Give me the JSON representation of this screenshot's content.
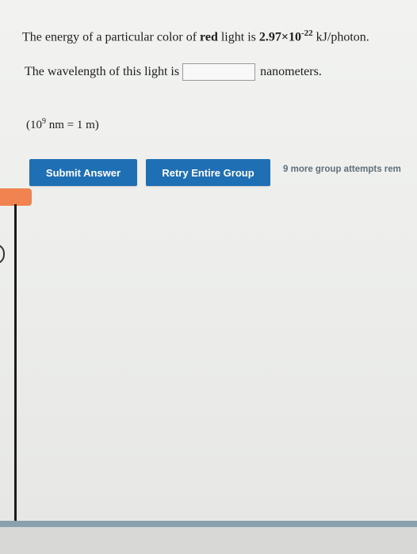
{
  "question": {
    "line1_prefix": "The energy of a particular color of",
    "line1_bold_red": "red",
    "line1_mid": "light is",
    "energy_value": "2.97×10",
    "energy_exponent": "-22",
    "energy_unit": "kJ/photon.",
    "line2_prefix": "The wavelength of this light is",
    "answer_value": "",
    "line2_suffix": "nanometers.",
    "note_open": "(10",
    "note_exponent": "9",
    "note_rest": " nm = 1 m)"
  },
  "buttons": {
    "submit_label": "Submit Answer",
    "retry_label": "Retry Entire Group"
  },
  "status": {
    "attempts_text": "9 more group attempts rem"
  },
  "colors": {
    "button_blue": "#1f6fb4",
    "tab_orange": "#f0834f",
    "bottom_bar": "#8aa1ad"
  }
}
